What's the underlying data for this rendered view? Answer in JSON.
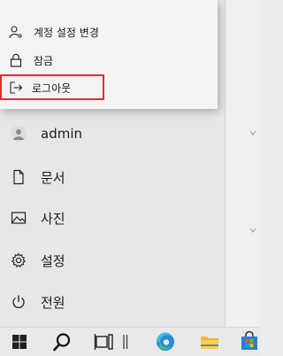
{
  "popup_menu": {
    "items": [
      {
        "label": "계정 설정 변경",
        "icon": "person-settings-icon"
      },
      {
        "label": "잠금",
        "icon": "lock-icon"
      },
      {
        "label": "로그아웃",
        "icon": "sign-out-icon"
      }
    ],
    "highlight_color": "#e02d2d"
  },
  "start_menu": {
    "user": {
      "name": "admin",
      "icon": "avatar"
    },
    "items": [
      {
        "label": "문서",
        "icon": "document-icon"
      },
      {
        "label": "사진",
        "icon": "pictures-icon"
      },
      {
        "label": "설정",
        "icon": "gear-icon"
      },
      {
        "label": "전원",
        "icon": "power-icon"
      }
    ]
  },
  "taskbar": {
    "icons": [
      "windows-start-icon",
      "search-icon",
      "task-view-icon",
      "separator",
      "edge-icon",
      "file-explorer-icon",
      "store-icon"
    ]
  }
}
